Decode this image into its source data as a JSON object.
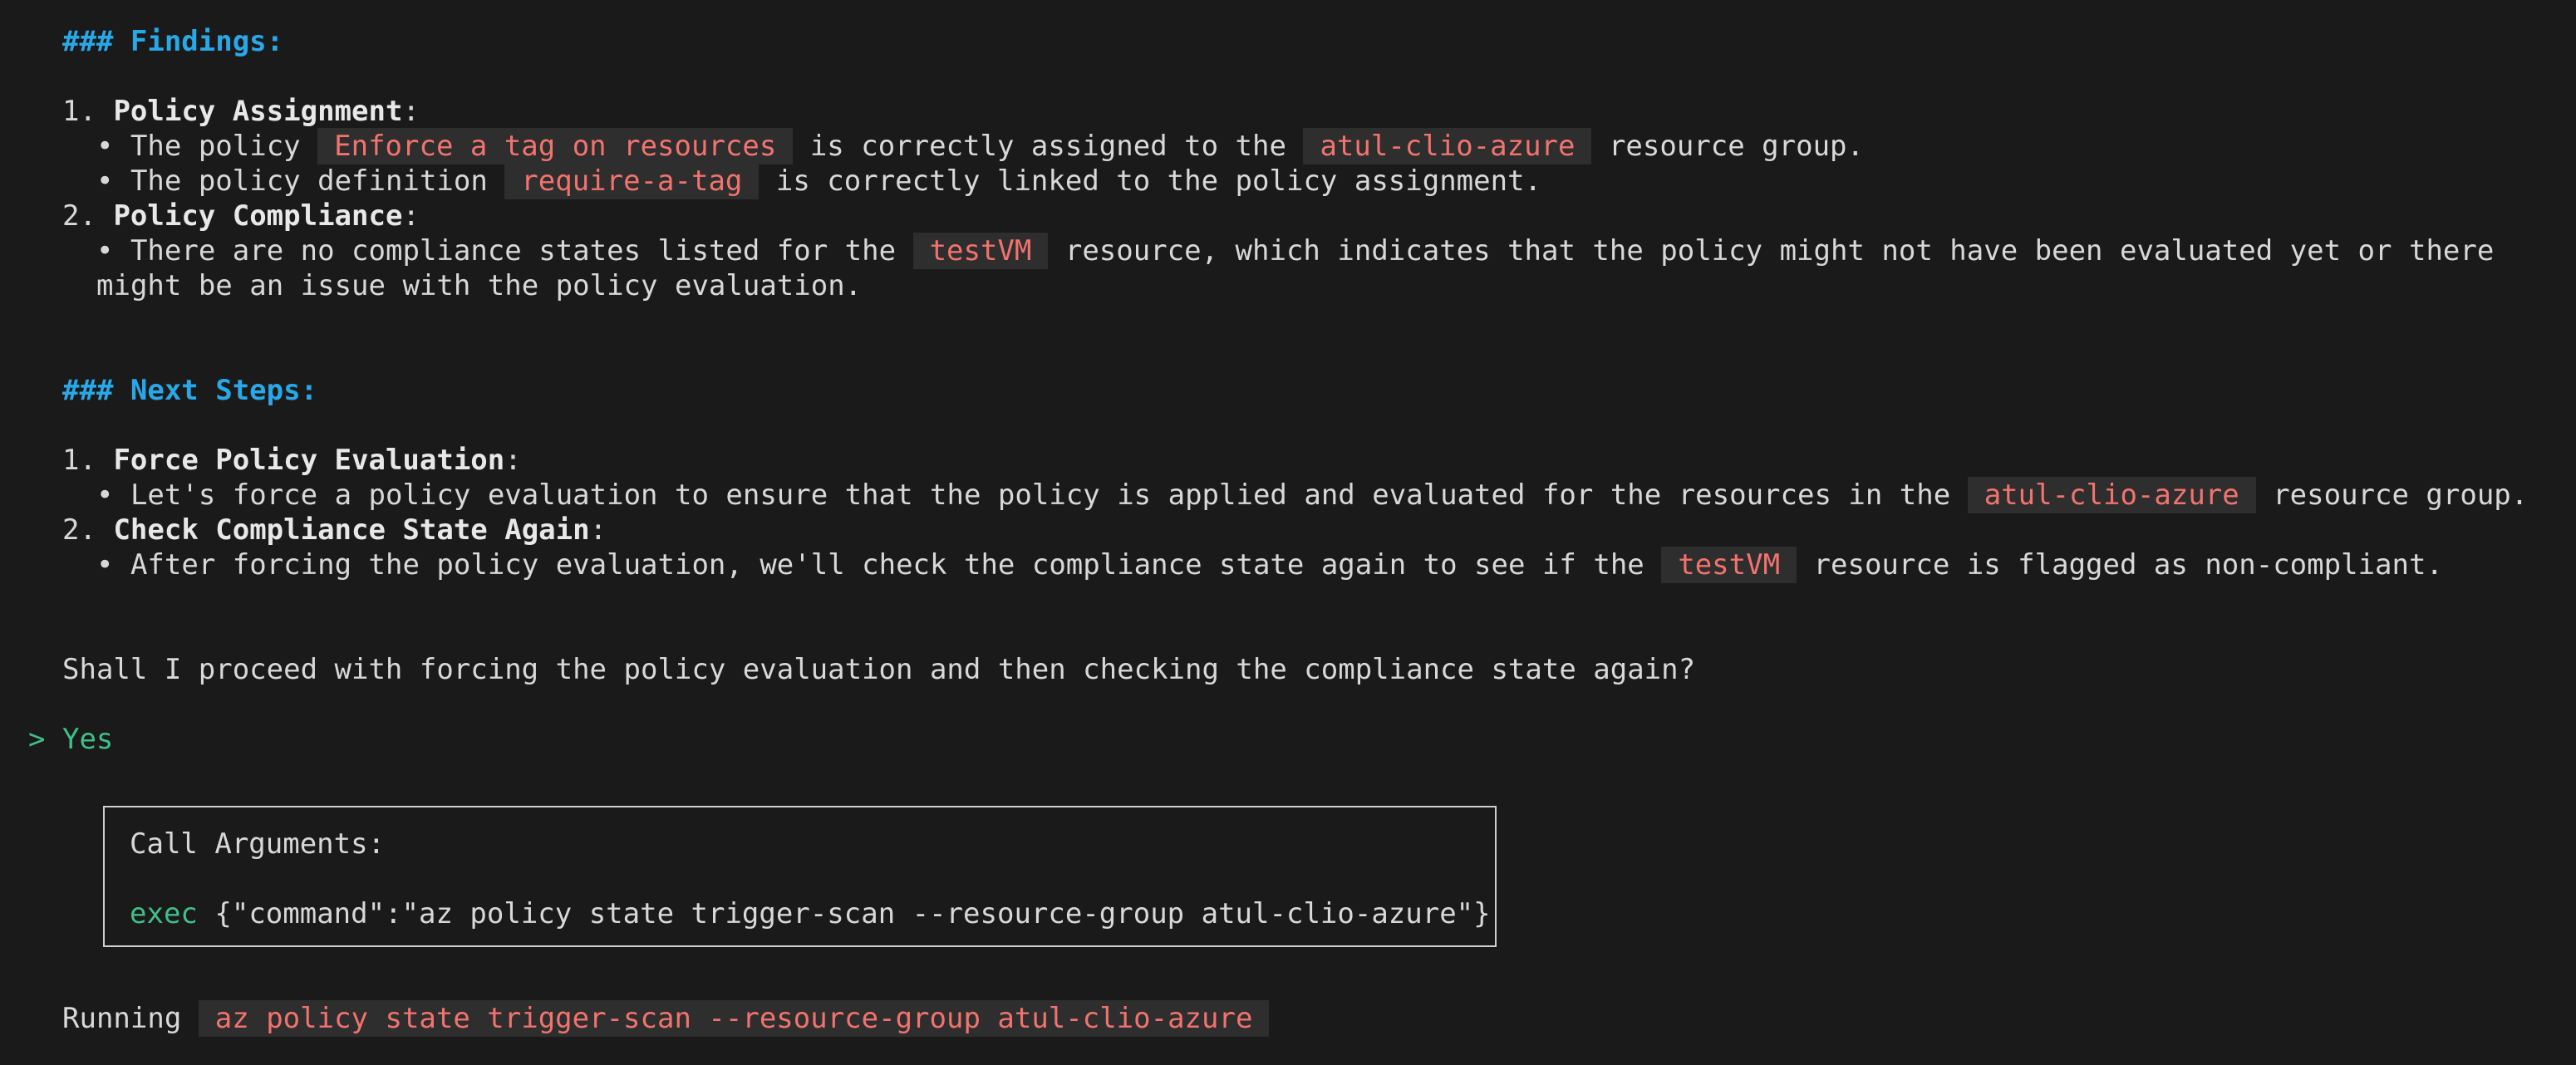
{
  "findings": {
    "heading": "### Findings:",
    "items": [
      {
        "number": "1.",
        "title": "Policy Assignment",
        "bullets": [
          {
            "pre": "The policy ",
            "code": "Enforce a tag on resources",
            "post": " is correctly assigned to the ",
            "code2": "atul-clio-azure",
            "post2": " resource group."
          },
          {
            "pre": "The policy definition ",
            "code": "require-a-tag",
            "post": " is correctly linked to the policy assignment."
          }
        ]
      },
      {
        "number": "2.",
        "title": "Policy Compliance",
        "bullets": [
          {
            "pre": "There are no compliance states listed for the ",
            "code": "testVM",
            "post": " resource, which indicates that the policy might not have been evaluated yet or there",
            "continuation": "might be an issue with the policy evaluation."
          }
        ]
      }
    ]
  },
  "next_steps": {
    "heading": "### Next Steps:",
    "items": [
      {
        "number": "1.",
        "title": "Force Policy Evaluation",
        "bullets": [
          {
            "pre": "Let's force a policy evaluation to ensure that the policy is applied and evaluated for the resources in the ",
            "code": "atul-clio-azure",
            "post": " resource group."
          }
        ]
      },
      {
        "number": "2.",
        "title": "Check Compliance State Again",
        "bullets": [
          {
            "pre": "After forcing the policy evaluation, we'll check the compliance state again to see if the ",
            "code": "testVM",
            "post": " resource is flagged as non-compliant."
          }
        ]
      }
    ]
  },
  "question": "Shall I proceed with forcing the policy evaluation and then checking the compliance state again?",
  "user_reply": {
    "prompt_symbol": ">",
    "text": "Yes"
  },
  "call_box": {
    "title": "Call Arguments:",
    "tool": "exec",
    "args": "{\"command\":\"az policy state trigger-scan --resource-group atul-clio-azure\"}"
  },
  "running": {
    "label": "Running",
    "command": "az policy state trigger-scan --resource-group atul-clio-azure"
  },
  "colors": {
    "background": "#1a1a1a",
    "heading": "#29a8e8",
    "code_text": "#f2736e",
    "code_bg": "#2e2e2e",
    "prompt": "#3fbf8a"
  }
}
